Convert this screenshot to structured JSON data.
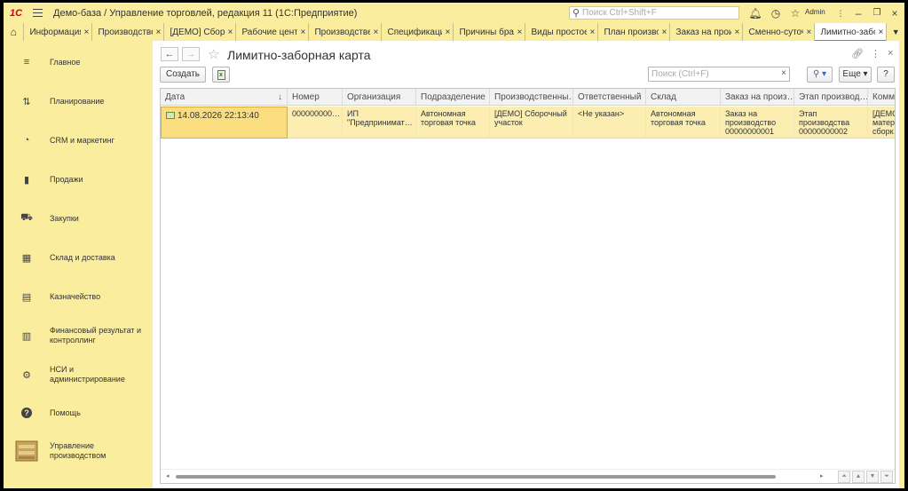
{
  "app": {
    "logo": "1С",
    "title": "Демо-база / Управление торговлей, редакция 11  (1С:Предприятие)",
    "search_placeholder": "Поиск Ctrl+Shift+F",
    "user": "Admin"
  },
  "tabs": [
    {
      "label": "Информация",
      "close": "×"
    },
    {
      "label": "Производственн…",
      "close": "×"
    },
    {
      "label": "[ДЕМО] Сборочный",
      "close": "×"
    },
    {
      "label": "Рабочие центры",
      "close": "×"
    },
    {
      "label": "Производственные",
      "close": "×"
    },
    {
      "label": "Спецификации",
      "close": "×"
    },
    {
      "label": "Причины брака",
      "close": "×"
    },
    {
      "label": "Виды простоев",
      "close": "×"
    },
    {
      "label": "План производства",
      "close": "×"
    },
    {
      "label": "Заказ на производство",
      "close": "×"
    },
    {
      "label": "Сменно-суточное",
      "close": "×"
    },
    {
      "label": "Лимитно-заборная",
      "close": "×"
    }
  ],
  "sidebar": {
    "items": [
      {
        "label": "Главное",
        "icon": "≡"
      },
      {
        "label": "Планирование",
        "icon": "⇅"
      },
      {
        "label": "CRM и маркетинг",
        "icon": "◔"
      },
      {
        "label": "Продажи",
        "icon": "▮"
      },
      {
        "label": "Закупки",
        "icon": "⛟"
      },
      {
        "label": "Склад и доставка",
        "icon": "▦"
      },
      {
        "label": "Казначейство",
        "icon": "▤"
      },
      {
        "label": "Финансовый результат и контроллинг",
        "icon": "▥"
      },
      {
        "label": "НСИ и администрирование",
        "icon": "⚙"
      },
      {
        "label": "Помощь",
        "icon": "?"
      },
      {
        "label": "Управление производством",
        "icon": ""
      }
    ]
  },
  "page": {
    "title": "Лимитно-заборная карта",
    "create_label": "Создать",
    "search_placeholder": "Поиск (Ctrl+F)",
    "more_label": "Еще",
    "help_label": "?"
  },
  "table": {
    "columns": [
      "Дата",
      "Номер",
      "Организация",
      "Подразделение",
      "Производственны…",
      "Ответственный",
      "Склад",
      "Заказ на произ…",
      "Этап производ…",
      "Комме"
    ],
    "rows": [
      {
        "cells": [
          "14.08.2026 22:13:40",
          "000000000…",
          "ИП \"Предпринимат…",
          "Автономная торговая точка",
          "[ДЕМО] Сборочный участок",
          "<Не указан>",
          "Автономная торговая точка",
          "Заказ на производство 00000000001 от…",
          "Этап производства 00000000002 от…",
          "[ДЕМО] матер… сборк…"
        ]
      }
    ]
  },
  "colors": {
    "panel_yellow": "#fbed9e",
    "selected_row": "#fbeeb0",
    "active_tab_accent": "#3db44a",
    "logo_red": "#d0001b"
  }
}
